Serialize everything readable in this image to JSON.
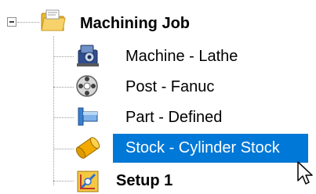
{
  "tree": {
    "root": {
      "label": "Machining Job",
      "icon": "folder-icon",
      "expanded": true
    },
    "children": [
      {
        "label": "Machine - Lathe",
        "icon": "machine-icon"
      },
      {
        "label": "Post - Fanuc",
        "icon": "post-icon"
      },
      {
        "label": "Part - Defined",
        "icon": "part-icon"
      },
      {
        "label": "Stock - Cylinder Stock",
        "icon": "stock-icon",
        "selected": true
      },
      {
        "label": "Setup 1",
        "icon": "setup-icon",
        "bold": true
      }
    ]
  },
  "colors": {
    "selection": "#0078d7",
    "connector": "#9a9a9a"
  }
}
